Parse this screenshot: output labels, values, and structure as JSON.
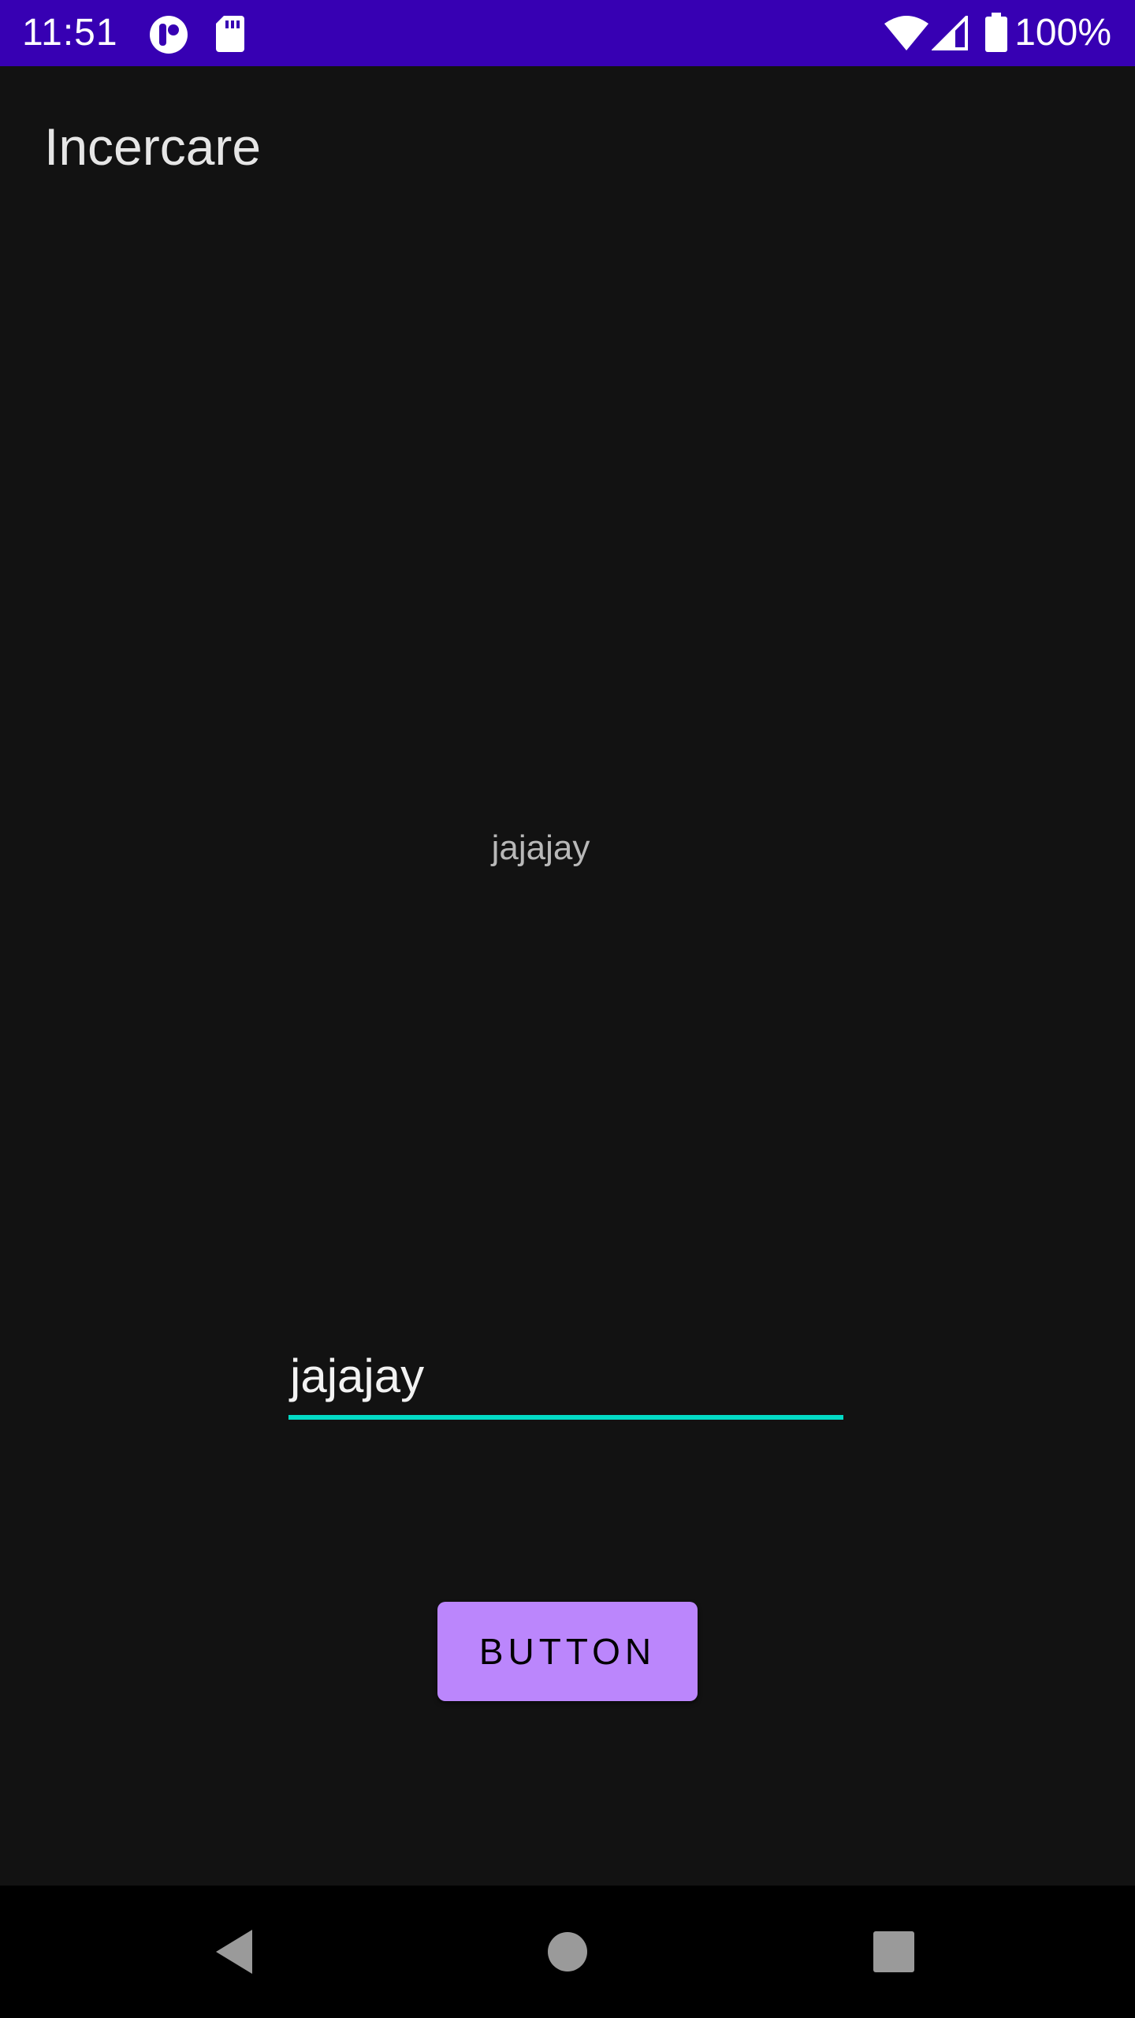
{
  "status_bar": {
    "time": "11:51",
    "battery_text": "100%",
    "background_color": "#3700B3",
    "icons": [
      "app-notification-icon",
      "sd-card-icon",
      "wifi-icon",
      "cellular-signal-icon",
      "battery-icon"
    ]
  },
  "app_bar": {
    "title": "Incercare"
  },
  "main": {
    "display_text": "jajajay",
    "input": {
      "value": "jajajay",
      "underline_color": "#03DAC5"
    },
    "button": {
      "label": "BUTTON",
      "color": "#BB86FC"
    }
  },
  "nav_bar": {
    "icons": [
      "back-icon",
      "home-icon",
      "recents-icon"
    ]
  }
}
